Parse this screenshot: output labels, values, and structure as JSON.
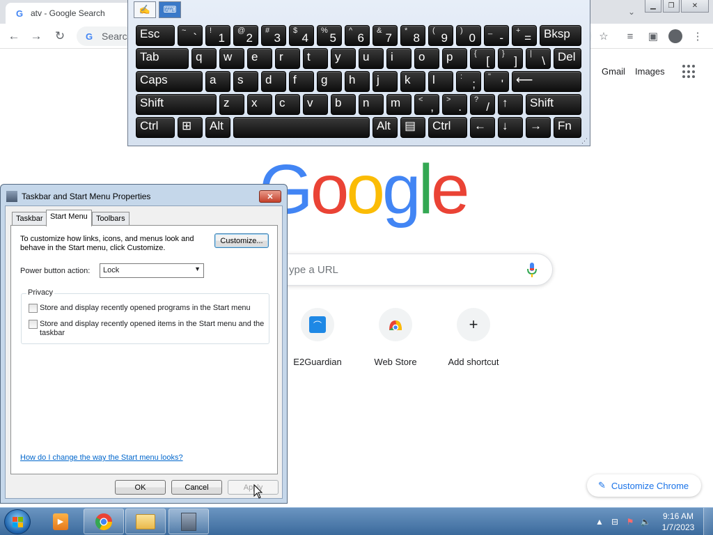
{
  "chrome": {
    "tab_title": "atv - Google Search",
    "omnibox_placeholder": "Search Google or type a URL",
    "omnibox_visible_text": "Search"
  },
  "google": {
    "gmail": "Gmail",
    "images": "Images",
    "logo_letters": [
      "G",
      "o",
      "o",
      "g",
      "l",
      "e"
    ],
    "logo_colors": [
      "#4285f4",
      "#ea4335",
      "#fbbc05",
      "#4285f4",
      "#34a853",
      "#ea4335"
    ],
    "search_visible_text": "ype a URL",
    "shortcuts": [
      {
        "label": "E2Guardian"
      },
      {
        "label": "Web Store"
      },
      {
        "label": "Add shortcut"
      }
    ],
    "customize_label": "Customize Chrome"
  },
  "osk": {
    "rows": [
      [
        {
          "main": "Esc",
          "kind": "wide"
        },
        {
          "main": "`",
          "shift": "~",
          "kind": "char"
        },
        {
          "main": "1",
          "shift": "!",
          "kind": "char"
        },
        {
          "main": "2",
          "shift": "@",
          "kind": "char"
        },
        {
          "main": "3",
          "shift": "#",
          "kind": "char"
        },
        {
          "main": "4",
          "shift": "$",
          "kind": "char"
        },
        {
          "main": "5",
          "shift": "%",
          "kind": "char"
        },
        {
          "main": "6",
          "shift": "^",
          "kind": "char"
        },
        {
          "main": "7",
          "shift": "&",
          "kind": "char"
        },
        {
          "main": "8",
          "shift": "*",
          "kind": "char"
        },
        {
          "main": "9",
          "shift": "(",
          "kind": "char"
        },
        {
          "main": "0",
          "shift": ")",
          "kind": "char"
        },
        {
          "main": "-",
          "shift": "_",
          "kind": "char"
        },
        {
          "main": "=",
          "shift": "+",
          "kind": "char"
        },
        {
          "main": "Bksp",
          "kind": "wide"
        }
      ],
      [
        {
          "main": "Tab",
          "kind": "wide"
        },
        {
          "main": "q",
          "kind": "letter"
        },
        {
          "main": "w",
          "kind": "letter"
        },
        {
          "main": "e",
          "kind": "letter"
        },
        {
          "main": "r",
          "kind": "letter"
        },
        {
          "main": "t",
          "kind": "letter"
        },
        {
          "main": "y",
          "kind": "letter"
        },
        {
          "main": "u",
          "kind": "letter"
        },
        {
          "main": "i",
          "kind": "letter"
        },
        {
          "main": "o",
          "kind": "letter"
        },
        {
          "main": "p",
          "kind": "letter"
        },
        {
          "main": "[",
          "shift": "{",
          "kind": "char"
        },
        {
          "main": "]",
          "shift": "}",
          "kind": "char"
        },
        {
          "main": "\\",
          "shift": "|",
          "kind": "char"
        },
        {
          "main": "Del",
          "kind": "wide"
        }
      ],
      [
        {
          "main": "Caps",
          "kind": "wide"
        },
        {
          "main": "a",
          "kind": "letter"
        },
        {
          "main": "s",
          "kind": "letter"
        },
        {
          "main": "d",
          "kind": "letter"
        },
        {
          "main": "f",
          "kind": "letter"
        },
        {
          "main": "g",
          "kind": "letter"
        },
        {
          "main": "h",
          "kind": "letter"
        },
        {
          "main": "j",
          "kind": "letter"
        },
        {
          "main": "k",
          "kind": "letter"
        },
        {
          "main": "l",
          "kind": "letter"
        },
        {
          "main": ";",
          "shift": ":",
          "kind": "char"
        },
        {
          "main": "'",
          "shift": "\"",
          "kind": "char"
        },
        {
          "main": "⟵",
          "kind": "wide"
        }
      ],
      [
        {
          "main": "Shift",
          "kind": "wide"
        },
        {
          "main": "z",
          "kind": "letter"
        },
        {
          "main": "x",
          "kind": "letter"
        },
        {
          "main": "c",
          "kind": "letter"
        },
        {
          "main": "v",
          "kind": "letter"
        },
        {
          "main": "b",
          "kind": "letter"
        },
        {
          "main": "n",
          "kind": "letter"
        },
        {
          "main": "m",
          "kind": "letter"
        },
        {
          "main": ",",
          "shift": "<",
          "kind": "char"
        },
        {
          "main": ".",
          "shift": ">",
          "kind": "char"
        },
        {
          "main": "/",
          "shift": "?",
          "kind": "char"
        },
        {
          "main": "↑",
          "kind": "wide"
        },
        {
          "main": "Shift",
          "kind": "wide"
        }
      ],
      [
        {
          "main": "Ctrl",
          "kind": "wide"
        },
        {
          "main": "⊞",
          "kind": "wide"
        },
        {
          "main": "Alt",
          "kind": "wide"
        },
        {
          "main": "",
          "kind": "wide"
        },
        {
          "main": "Alt",
          "kind": "wide"
        },
        {
          "main": "▤",
          "kind": "wide"
        },
        {
          "main": "Ctrl",
          "kind": "wide"
        },
        {
          "main": "←",
          "kind": "wide"
        },
        {
          "main": "↓",
          "kind": "wide"
        },
        {
          "main": "→",
          "kind": "wide"
        },
        {
          "main": "Fn",
          "kind": "wide"
        }
      ]
    ]
  },
  "dialog": {
    "title": "Taskbar and Start Menu Properties",
    "close_label": "✕",
    "tabs": [
      "Taskbar",
      "Start Menu",
      "Toolbars"
    ],
    "description": "To customize how links, icons, and menus look and behave in the Start menu, click Customize.",
    "customize_button": "Customize...",
    "power_label": "Power button action:",
    "power_value": "Lock",
    "privacy_legend": "Privacy",
    "privacy_options": [
      {
        "label": "Store and display recently opened programs in the Start menu",
        "checked": false
      },
      {
        "label": "Store and display recently opened items in the Start menu and the taskbar",
        "checked": false
      }
    ],
    "help_link": "How do I change the way the Start menu looks?",
    "ok": "OK",
    "cancel": "Cancel",
    "apply": "Apply"
  },
  "taskbar": {
    "time": "9:16 AM",
    "date": "1/7/2023"
  }
}
